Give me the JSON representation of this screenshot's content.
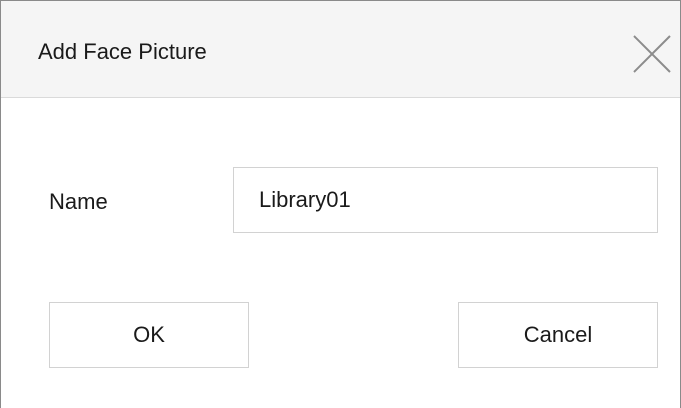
{
  "dialog": {
    "title": "Add Face Picture",
    "close_icon": "close-icon"
  },
  "form": {
    "name_label": "Name",
    "name_value": "Library01"
  },
  "buttons": {
    "ok_label": "OK",
    "cancel_label": "Cancel"
  }
}
